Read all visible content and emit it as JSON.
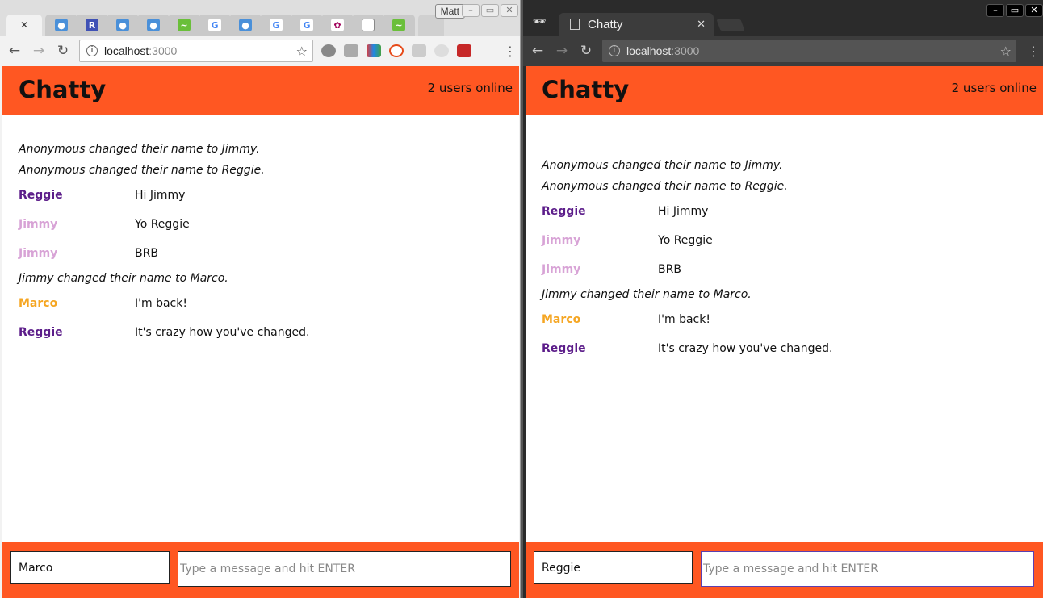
{
  "left_window": {
    "profile_name": "Matt",
    "tab_favicons": [
      "paw-icon",
      "r-icon",
      "paw-icon",
      "paw-icon",
      "code-icon",
      "google-icon",
      "paw-icon",
      "google-icon",
      "google-icon",
      "pawprint-icon",
      "doc-icon",
      "code-icon"
    ],
    "address": {
      "host": "localhost",
      "port": ":3000"
    },
    "app": {
      "title": "Chatty",
      "users_online": "2 users online",
      "messages": [
        {
          "type": "system",
          "text": "Anonymous changed their name to Jimmy."
        },
        {
          "type": "system",
          "text": "Anonymous changed their name to Reggie."
        },
        {
          "type": "message",
          "user": "Reggie",
          "color": "#5c1d8a",
          "content": "Hi Jimmy"
        },
        {
          "type": "message",
          "user": "Jimmy",
          "color": "#d8a3d6",
          "content": "Yo Reggie"
        },
        {
          "type": "message",
          "user": "Jimmy",
          "color": "#d8a3d6",
          "content": "BRB"
        },
        {
          "type": "system",
          "text": "Jimmy changed their name to Marco."
        },
        {
          "type": "message",
          "user": "Marco",
          "color": "#f5a623",
          "content": "I'm back!"
        },
        {
          "type": "message",
          "user": "Reggie",
          "color": "#5c1d8a",
          "content": "It's crazy how you've changed."
        }
      ],
      "name_value": "Marco",
      "message_placeholder": "Type a message and hit ENTER"
    }
  },
  "right_window": {
    "tab_title": "Chatty",
    "address": {
      "host": "localhost",
      "port": ":3000"
    },
    "app": {
      "title": "Chatty",
      "users_online": "2 users online",
      "messages": [
        {
          "type": "system",
          "text": "Anonymous changed their name to Jimmy."
        },
        {
          "type": "system",
          "text": "Anonymous changed their name to Reggie."
        },
        {
          "type": "message",
          "user": "Reggie",
          "color": "#5c1d8a",
          "content": "Hi Jimmy"
        },
        {
          "type": "message",
          "user": "Jimmy",
          "color": "#d8a3d6",
          "content": "Yo Reggie"
        },
        {
          "type": "message",
          "user": "Jimmy",
          "color": "#d8a3d6",
          "content": "BRB"
        },
        {
          "type": "system",
          "text": "Jimmy changed their name to Marco."
        },
        {
          "type": "message",
          "user": "Marco",
          "color": "#f5a623",
          "content": "I'm back!"
        },
        {
          "type": "message",
          "user": "Reggie",
          "color": "#5c1d8a",
          "content": "It's crazy how you've changed."
        }
      ],
      "name_value": "Reggie",
      "message_placeholder": "Type a message and hit ENTER"
    }
  },
  "colors": {
    "header_accent": "#ff5722"
  }
}
